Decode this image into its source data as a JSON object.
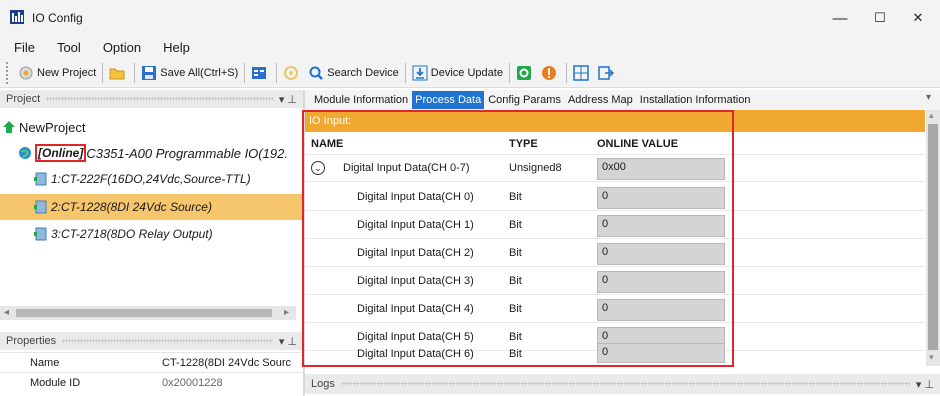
{
  "window": {
    "title": "IO Config",
    "minimize": "—",
    "maximize": "☐",
    "close": "✕"
  },
  "menu": [
    "File",
    "Tool",
    "Option",
    "Help"
  ],
  "toolbar": {
    "new_project": "New Project",
    "save_all": "Save All(Ctrl+S)",
    "search_device": "Search Device",
    "device_update": "Device Update"
  },
  "project_panel": {
    "title": "Project",
    "root": "NewProject",
    "device_status": "[Online]",
    "device_name": "C3351-A00 Programmable IO(192.",
    "modules": [
      "1:CT-222F(16DO,24Vdc,Source-TTL)",
      "2:CT-1228(8DI 24Vdc Source)",
      "3:CT-2718(8DO Relay Output)"
    ]
  },
  "properties_panel": {
    "title": "Properties",
    "rows": [
      {
        "key": "Name",
        "value": "CT-1228(8DI 24Vdc Sourc"
      },
      {
        "key": "Module ID",
        "value": "0x20001228"
      }
    ]
  },
  "tabs": [
    "Module Information",
    "Process Data",
    "Config Params",
    "Address Map",
    "Installation Information"
  ],
  "active_tab": "Process Data",
  "process_data": {
    "section": "IO Input:",
    "columns": {
      "name": "NAME",
      "type": "TYPE",
      "value": "ONLINE VALUE"
    },
    "group": {
      "name": "Digital Input Data(CH 0-7)",
      "type": "Unsigned8",
      "value": "0x00"
    },
    "rows": [
      {
        "name": "Digital Input Data(CH 0)",
        "type": "Bit",
        "value": "0"
      },
      {
        "name": "Digital Input Data(CH 1)",
        "type": "Bit",
        "value": "0"
      },
      {
        "name": "Digital Input Data(CH 2)",
        "type": "Bit",
        "value": "0"
      },
      {
        "name": "Digital Input Data(CH 3)",
        "type": "Bit",
        "value": "0"
      },
      {
        "name": "Digital Input Data(CH 4)",
        "type": "Bit",
        "value": "0"
      },
      {
        "name": "Digital Input Data(CH 5)",
        "type": "Bit",
        "value": "0"
      },
      {
        "name": "Digital Input Data(CH 6)",
        "type": "Bit",
        "value": "0"
      }
    ]
  },
  "logs_panel": {
    "title": "Logs"
  },
  "colors": {
    "accent": "#1e74d0",
    "header_orange": "#f0a830",
    "selected": "#f5c66b",
    "highlight_red": "#e0262b"
  }
}
